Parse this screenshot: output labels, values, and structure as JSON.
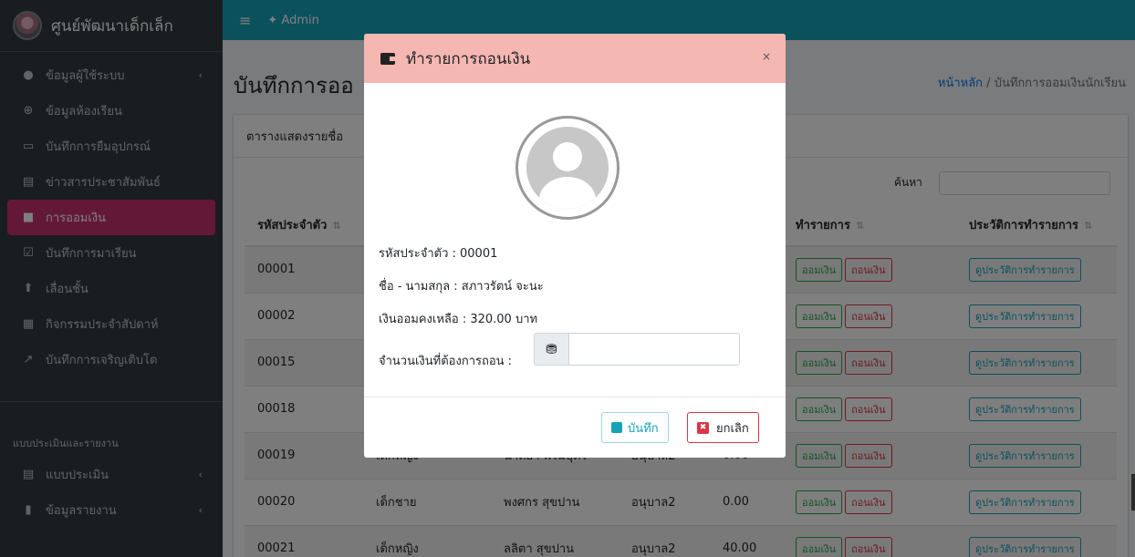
{
  "sidebar": {
    "brand": "ศูนย์พัฒนาเด็กเล็ก",
    "items": [
      {
        "label": "ข้อมูลผู้ใช้ระบบ",
        "icon": "user-circle-icon",
        "glyph": "●",
        "has_children": true
      },
      {
        "label": "ข้อมูลห้องเรียน",
        "icon": "plus-circle-icon",
        "glyph": "⊕",
        "has_children": false
      },
      {
        "label": "บันทึกการยืมอุปกรณ์",
        "icon": "laptop-icon",
        "glyph": "▭",
        "has_children": false
      },
      {
        "label": "ข่าวสารประชาสัมพันธ์",
        "icon": "newspaper-icon",
        "glyph": "▤",
        "has_children": false
      },
      {
        "label": "การออมเงิน",
        "icon": "wallet-icon",
        "glyph": "■",
        "has_children": false,
        "active": true
      },
      {
        "label": "บันทึกการมาเรียน",
        "icon": "calendar-check-icon",
        "glyph": "☑",
        "has_children": false
      },
      {
        "label": "เลื่อนชั้น",
        "icon": "arrow-circle-up-icon",
        "glyph": "⬆",
        "has_children": false
      },
      {
        "label": "กิจกรรมประจำสัปดาห์",
        "icon": "calendar-icon",
        "glyph": "▦",
        "has_children": false
      },
      {
        "label": "บันทึกการเจริญเติบโต",
        "icon": "chart-line-icon",
        "glyph": "↗",
        "has_children": false
      }
    ],
    "section_header": "แบบประเมินและรายงาน",
    "section_items": [
      {
        "label": "แบบประเมิน",
        "icon": "clipboard-icon",
        "glyph": "▤",
        "has_children": true
      },
      {
        "label": "ข้อมูลรายงาน",
        "icon": "book-icon",
        "glyph": "▮",
        "has_children": true
      }
    ],
    "chevron": "‹"
  },
  "topbar": {
    "menu_glyph": "≡",
    "user_label": "Admin",
    "user_glyph": "✦"
  },
  "page": {
    "title": "บันทึกการออ",
    "breadcrumb_home": "หน้าหลัก",
    "breadcrumb_sep": " / ",
    "breadcrumb_current": "บันทึกการออมเงินนักเรียน",
    "card_title": "ตารางแสดงรายชื่อ",
    "search_label": "ค้นหา"
  },
  "table": {
    "headers": [
      "รหัสประจำตัว",
      "",
      "",
      "",
      "",
      "ทำรายการ",
      "ประวัติการทำรายการ"
    ],
    "sort_glyph": "⇅",
    "rows": [
      {
        "id": "00001",
        "gender": "",
        "name": "",
        "level": "",
        "balance": ""
      },
      {
        "id": "00002",
        "gender": "",
        "name": "",
        "level": "",
        "balance": ""
      },
      {
        "id": "00015",
        "gender": "",
        "name": "",
        "level": "",
        "balance": ""
      },
      {
        "id": "00018",
        "gender": "",
        "name": "",
        "level": "",
        "balance": ""
      },
      {
        "id": "00019",
        "gender": "เด็กหญิง",
        "name": "นาตยา พรมบุตร",
        "level": "อนุบาล2",
        "balance": "0.00"
      },
      {
        "id": "00020",
        "gender": "เด็กชาย",
        "name": "พงศกร สุขปาน",
        "level": "อนุบาล2",
        "balance": "0.00"
      },
      {
        "id": "00021",
        "gender": "เด็กหญิง",
        "name": "ลลิตา สุขปาน",
        "level": "อนุบาล2",
        "balance": "40.00"
      }
    ],
    "deposit_label": "ออมเงิน",
    "withdraw_label": "ถอนเงิน",
    "history_label": "ดูประวัติการทำรายการ"
  },
  "modal": {
    "title": "ทำรายการถอนเงิน",
    "close": "×",
    "student_id_line": "รหัสประจำตัว : 00001",
    "name_line": "ชื่อ - นามสกุล : สภาวรัตน์ จะนะ",
    "balance_line": "เงินออมคงเหลือ : 320.00 บาท",
    "amount_label": "จำนวนเงินที่ต้องการถอน :",
    "amount_value": "",
    "amount_glyph": "⛃",
    "save_label": "บันทึก",
    "cancel_label": "ยกเลิก",
    "cancel_glyph": "✖"
  },
  "colors": {
    "sidebar_bg": "#343a40",
    "topbar_bg": "#17a2b8",
    "active_item": "#c8306e",
    "modal_header": "#f5b7b1"
  }
}
